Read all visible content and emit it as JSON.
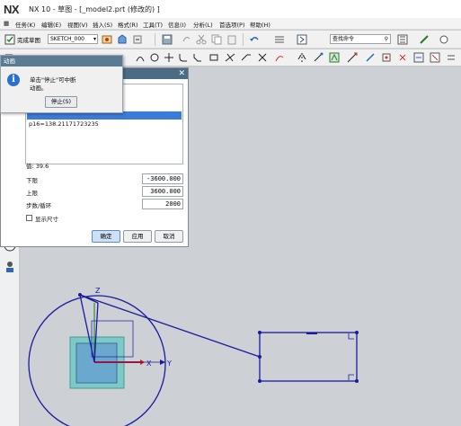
{
  "titlebar": {
    "logo": "NX",
    "title": "NX 10 - 草图 - [_model2.prt  (修改的) ]"
  },
  "menubar": {
    "items": [
      "任务(K)",
      "编辑(E)",
      "视图(V)",
      "插入(S)",
      "格式(R)",
      "工具(T)",
      "信息(I)",
      "分析(L)",
      "首选项(P)",
      "帮助(H)"
    ]
  },
  "toolbar": {
    "finish_sketch": "完成草图",
    "sketch_name": "SKETCH_000",
    "search_placeholder": "查找命令"
  },
  "popup": {
    "title": "动画",
    "message_line1": "单击\"停止\"可中断",
    "message_line2": "动画。",
    "stop_button": "停止(S)"
  },
  "dialog": {
    "list_item": "p16=138.21171723235",
    "value_label": "值: 39.6",
    "lower_label": "下限",
    "lower_value": "-3600.000",
    "upper_label": "上限",
    "upper_value": "3600.000",
    "steps_label": "步数/循环",
    "steps_value": "2000",
    "show_dims_label": "显示尺寸",
    "ok_button": "确定",
    "apply_button": "应用",
    "cancel_button": "取消"
  },
  "sketch": {
    "axis_x": "X",
    "axis_y": "Y",
    "axis_z": "Z",
    "colors": {
      "curve": "#1a1a9e",
      "square_outer": "#7ac6c4",
      "square_inner": "#5aa0c8",
      "xaxis": "#e01414",
      "yaxis": "#1e7a1e"
    }
  }
}
